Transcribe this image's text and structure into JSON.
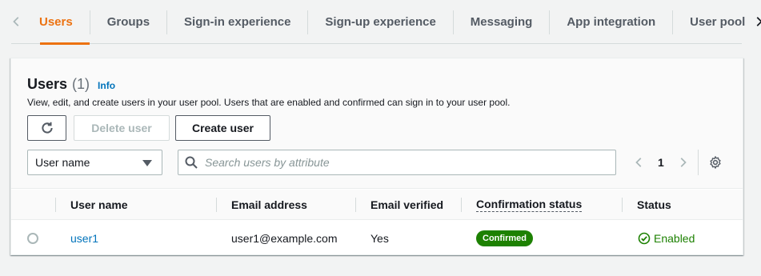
{
  "tabs": [
    {
      "label": "Users",
      "active": true
    },
    {
      "label": "Groups"
    },
    {
      "label": "Sign-in experience"
    },
    {
      "label": "Sign-up experience"
    },
    {
      "label": "Messaging"
    },
    {
      "label": "App integration"
    },
    {
      "label": "User pool"
    }
  ],
  "panel": {
    "title": "Users",
    "count": "(1)",
    "info_link": "Info",
    "description": "View, edit, and create users in your user pool. Users that are enabled and confirmed can sign in to your user pool.",
    "delete_button": "Delete user",
    "create_button": "Create user",
    "filter_select": "User name",
    "search_placeholder": "Search users by attribute",
    "page": "1"
  },
  "table": {
    "columns": [
      "User name",
      "Email address",
      "Email verified",
      "Confirmation status",
      "Status"
    ],
    "rows": [
      {
        "user_name": "user1",
        "email": "user1@example.com",
        "email_verified": "Yes",
        "confirmation_status": "Confirmed",
        "status": "Enabled"
      }
    ]
  },
  "colors": {
    "active_tab": "#ec7211",
    "link": "#0073bb",
    "success": "#1d8102"
  }
}
